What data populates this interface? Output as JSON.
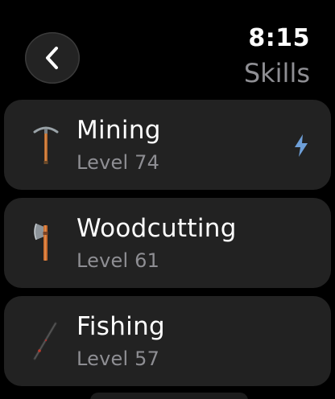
{
  "header": {
    "time": "8:15",
    "title": "Skills",
    "back_icon": "chevron-left-icon"
  },
  "skills": [
    {
      "name": "Mining",
      "level": "Level 74",
      "icon": "pickaxe-icon",
      "boosted": true
    },
    {
      "name": "Woodcutting",
      "level": "Level 61",
      "icon": "axe-icon",
      "boosted": false
    },
    {
      "name": "Fishing",
      "level": "Level 57",
      "icon": "fishing-rod-icon",
      "boosted": false
    }
  ],
  "colors": {
    "background": "#000000",
    "card": "#222222",
    "secondary_text": "#8e8e93",
    "boost_accent": "#6e9fd8"
  }
}
